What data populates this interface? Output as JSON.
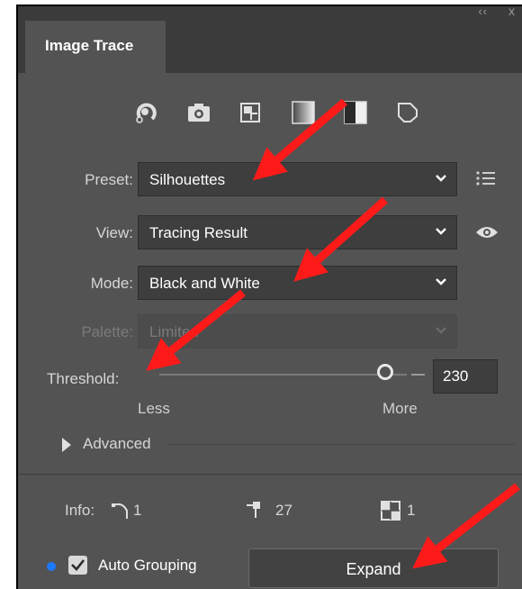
{
  "window": {
    "collapse_icon": "‹‹",
    "close_icon": "x"
  },
  "panel": {
    "tab_title": "Image Trace"
  },
  "presets_icons": [
    "auto-color-icon",
    "high-color-icon",
    "low-color-icon",
    "grayscale-icon",
    "black-and-white-icon",
    "outline-icon"
  ],
  "preset": {
    "label": "Preset:",
    "value": "Silhouettes"
  },
  "view": {
    "label": "View:",
    "value": "Tracing Result"
  },
  "mode": {
    "label": "Mode:",
    "value": "Black and White"
  },
  "palette": {
    "label": "Palette:",
    "value": "Limited"
  },
  "threshold": {
    "label": "Threshold:",
    "value": "230",
    "min_label": "Less",
    "max_label": "More",
    "level_fraction": 0.9
  },
  "advanced": {
    "label": "Advanced"
  },
  "info": {
    "label": "Info:",
    "paths": "1",
    "anchors": "27",
    "colors": "1"
  },
  "auto_grouping": {
    "label": "Auto Grouping",
    "checked": true
  },
  "expand_button": {
    "label": "Expand"
  },
  "colors": {
    "panel_bg": "#535353",
    "field_bg": "#3e3e3e",
    "accent_dot": "#1f79ff",
    "arrow": "#ff1a1a"
  }
}
